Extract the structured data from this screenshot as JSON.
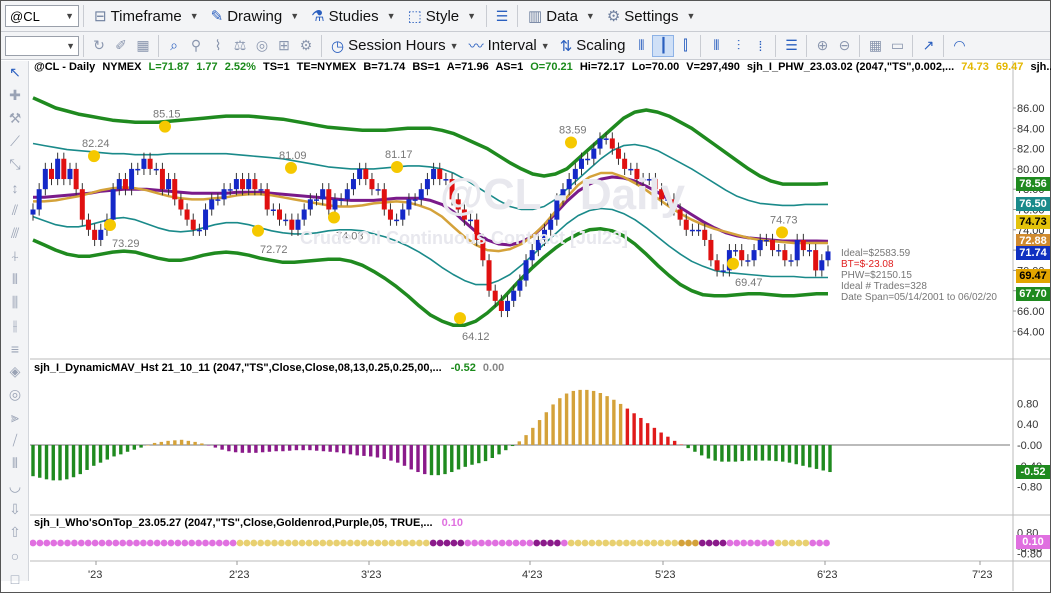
{
  "toolbar": {
    "symbol": "@CL",
    "timeframe": "Timeframe",
    "drawing": "Drawing",
    "studies": "Studies",
    "style": "Style",
    "data": "Data",
    "settings": "Settings",
    "session_hours": "Session Hours",
    "interval": "Interval",
    "scaling": "Scaling"
  },
  "legend": {
    "symbol": "@CL - Daily",
    "exchange": "NYMEX",
    "last": "L=71.87",
    "change": "1.77",
    "pct": "2.52%",
    "ts": "TS=1",
    "te": "TE=NYMEX",
    "bid": "B=71.74",
    "bs": "BS=1",
    "ask": "A=71.96",
    "as": "AS=1",
    "open": "O=70.21",
    "hi": "Hi=72.17",
    "lo": "Lo=70.00",
    "vol": "V=297,490",
    "study": "sjh_I_PHW_23.03.02 (2047,\"TS\",0.002,...",
    "v1": "74.73",
    "v2": "69.47",
    "tail": "sjh..."
  },
  "watermark": {
    "main": "@CL - Daily",
    "sub": "Crude Oil Continuous Contract [Jul23]"
  },
  "stats": [
    "Ideal=$2583.59",
    "BT=$-23.08",
    "PHW=$2150.15",
    "Ideal # Trades=328",
    "Date Span=05/14/2001 to 06/02/20"
  ],
  "indicator1": {
    "label": "sjh_I_DynamicMAV_Hst 21_10_11 (2047,\"TS\",Close,Close,08,13,0.25,0.25,00,...",
    "v1": "-0.52",
    "v2": "0.00"
  },
  "indicator2": {
    "label": "sjh_I_Who'sOnTop_23.05.27 (2047,\"TS\",Close,Goldenrod,Purple,05,  TRUE,...",
    "v1": "0.10"
  },
  "price_axis": [
    "86.00",
    "84.00",
    "82.00",
    "80.00",
    "78.00",
    "76.00",
    "74.00",
    "72.00",
    "70.00",
    "68.00",
    "66.00",
    "64.00"
  ],
  "price_boxes": [
    {
      "label": "78.56",
      "color": "#1f8a1f",
      "value": 78.56
    },
    {
      "label": "76.50",
      "color": "#1a8a8a",
      "value": 76.5
    },
    {
      "label": "74.73",
      "color": "#e3c20a",
      "value": 74.73
    },
    {
      "label": "72.88",
      "color": "#d08a2e",
      "value": 72.9
    },
    {
      "label": "71.74",
      "color": "#1030c0",
      "value": 71.74
    },
    {
      "label": "69.47",
      "color": "#e3a500",
      "value": 69.47
    },
    {
      "label": "67.70",
      "color": "#1f8a1f",
      "value": 67.7
    }
  ],
  "ind1_axis": [
    "0.80",
    "0.40",
    "-0.00",
    "-0.40",
    "-0.80"
  ],
  "ind1_box": {
    "label": "-0.52",
    "value": -0.52
  },
  "ind2_axis": [
    "0.80",
    "0.10",
    "-0.40",
    "-0.80"
  ],
  "ind2_box": {
    "label": "0.10",
    "value": 0.1
  },
  "x_axis": [
    "'23",
    "2'23",
    "3'23",
    "4'23",
    "5'23",
    "6'23",
    "7'23"
  ],
  "peak_labels": [
    "82.24",
    "85.15",
    "81.09",
    "81.17",
    "83.59",
    "74.73"
  ],
  "trough_labels": [
    "73.29",
    "72.72",
    "74.03",
    "64.12",
    "69.47"
  ],
  "colors": {
    "up": "#1428c8",
    "down": "#e01010",
    "outer": "#1f8a1f",
    "inner": "#1a8a8a",
    "purple": "#7a1a8a",
    "gold": "#d4a23a",
    "dot": "#f5c800"
  },
  "chart_data": {
    "type": "line",
    "price_range": [
      63,
      87
    ],
    "x_range": [
      0,
      160
    ],
    "close": [
      76,
      78,
      80,
      79,
      81,
      79,
      80,
      78,
      75,
      74,
      73,
      74,
      75,
      78,
      79,
      78,
      80,
      80,
      81,
      80,
      80,
      78,
      79,
      77,
      76,
      75,
      74,
      74,
      76,
      77,
      77,
      78,
      78,
      79,
      78,
      79,
      78,
      78,
      76,
      76,
      75,
      75,
      74,
      75,
      76,
      77,
      77,
      78,
      76,
      77,
      77,
      78,
      79,
      80,
      79,
      78,
      78,
      76,
      75,
      75,
      76,
      77,
      77,
      78,
      79,
      80,
      79,
      79,
      77,
      76,
      75,
      75,
      73,
      71,
      68,
      67,
      66,
      67,
      68,
      69,
      71,
      72,
      73,
      74,
      75,
      77,
      78,
      79,
      80,
      81,
      81,
      82,
      83,
      83,
      82,
      81,
      80,
      80,
      79,
      79,
      79,
      78,
      77,
      77,
      76,
      75,
      74,
      74,
      74,
      73,
      71,
      70,
      70,
      72,
      72,
      71,
      71,
      72,
      73,
      73,
      72,
      72,
      71,
      71,
      73,
      72,
      72,
      70,
      71,
      71.87
    ],
    "outer_upper": [
      87,
      86.5,
      86,
      85.7,
      85.4,
      85.2,
      85,
      84.8,
      84.7,
      84.6,
      84.6,
      84.6,
      84.7,
      84.8,
      84.9,
      85,
      85.1,
      85.2,
      85.2,
      85.2,
      85.1,
      85,
      84.9,
      84.7,
      84.5,
      84.3,
      84.1,
      84,
      83.9,
      83.8,
      83.8,
      83.8,
      83.9,
      84,
      84,
      84,
      83.8,
      83.5,
      83,
      82.5,
      82,
      81.3,
      80.6,
      80,
      79.5,
      79.3,
      79.5,
      80,
      81,
      82,
      83,
      84,
      85,
      85.6,
      85.8,
      85.6,
      85.2,
      84.6,
      84,
      83.2,
      82.4,
      81.6,
      80.8,
      80,
      79.3,
      78.8,
      78.5,
      78.5,
      78.5,
      78.5,
      78.56
    ],
    "inner_upper": [
      82.5,
      82.3,
      82.1,
      81.9,
      81.8,
      81.7,
      81.6,
      81.5,
      81.5,
      81.4,
      81.4,
      81.4,
      81.5,
      81.5,
      81.5,
      81.5,
      81.5,
      81.5,
      81.4,
      81.3,
      81.2,
      81.1,
      81,
      80.8,
      80.6,
      80.4,
      80.2,
      80.1,
      80,
      80,
      80,
      80.1,
      80.2,
      80.3,
      80.3,
      80.2,
      80,
      79.6,
      79,
      78.3,
      77.6,
      76.9,
      76.3,
      76,
      76,
      76.3,
      77,
      78,
      79,
      80,
      81,
      81.8,
      82.3,
      82.4,
      82.2,
      81.8,
      81.2,
      80.6,
      80,
      79.3,
      78.6,
      77.9,
      77.3,
      76.9,
      76.6,
      76.5,
      76.4,
      76.4,
      76.5,
      76.5,
      76.5
    ],
    "purple": [
      77.2,
      77.2,
      77.3,
      77.4,
      77.5,
      77.6,
      77.8,
      77.9,
      78,
      78,
      78,
      77.9,
      77.8,
      77.7,
      77.6,
      77.6,
      77.6,
      77.6,
      77.7,
      77.7,
      77.7,
      77.6,
      77.5,
      77.4,
      77.3,
      77.2,
      77.1,
      77,
      76.9,
      76.9,
      76.9,
      77,
      77.1,
      77.1,
      77.1,
      76.9,
      76.5,
      75.8,
      74.8,
      73.8,
      73,
      72.6,
      72.5,
      72.8,
      73.4,
      74.4,
      75.6,
      76.8,
      77.8,
      78.5,
      79,
      79.2,
      79.1,
      78.8,
      78.3,
      77.7,
      77,
      76.2,
      75.5,
      74.8,
      74.2,
      73.7,
      73.4,
      73.2,
      73.1,
      73,
      72.9,
      72.9,
      72.9,
      72.9,
      72.88
    ],
    "gold": [
      76.8,
      76.8,
      76.9,
      77.1,
      77.3,
      77.6,
      77.9,
      78.1,
      78.2,
      78.1,
      77.9,
      77.6,
      77.3,
      77.1,
      77,
      77,
      77.1,
      77.2,
      77.4,
      77.5,
      77.5,
      77.4,
      77.2,
      77,
      76.8,
      76.6,
      76.4,
      76.3,
      76.3,
      76.4,
      76.6,
      76.7,
      76.8,
      76.7,
      76.4,
      76,
      75.3,
      74.3,
      73.3,
      72.5,
      72,
      71.9,
      72.1,
      72.6,
      73.4,
      74.5,
      75.8,
      77.2,
      78.4,
      79.2,
      79.6,
      79.6,
      79.2,
      78.6,
      77.9,
      77.1,
      76.3,
      75.6,
      75,
      74.5,
      74.1,
      73.8,
      73.5,
      73.2,
      73,
      72.9,
      72.8,
      72.7,
      72.7,
      72.7,
      72.7
    ],
    "inner_lower": [
      75.3,
      74.9,
      74.5,
      74.3,
      74.3,
      74.5,
      74.8,
      75.1,
      75.2,
      75,
      74.6,
      74.2,
      73.9,
      73.8,
      73.9,
      74.2,
      74.5,
      74.7,
      74.7,
      74.5,
      74.2,
      73.9,
      73.7,
      73.6,
      73.6,
      73.7,
      73.9,
      74,
      74,
      73.9,
      73.6,
      73.3,
      72.9,
      72.4,
      71.8,
      71.1,
      70.3,
      69.6,
      69,
      68.6,
      68.6,
      69,
      69.6,
      70.5,
      71.5,
      72.6,
      73.6,
      74.6,
      75.4,
      75.9,
      76.1,
      76,
      75.6,
      75,
      74.2,
      73.3,
      72.4,
      71.6,
      70.9,
      70.4,
      70,
      69.8,
      69.7,
      69.6,
      69.5,
      69.4,
      69.4,
      69.4,
      69.3,
      69.3,
      69.3
    ],
    "outer_lower": [
      73,
      72.5,
      72,
      71.6,
      71.4,
      71.4,
      71.6,
      71.8,
      71.9,
      71.8,
      71.5,
      71.2,
      71,
      71,
      71.2,
      71.5,
      71.7,
      71.8,
      71.7,
      71.5,
      71.2,
      71,
      70.8,
      70.8,
      70.9,
      71,
      71.1,
      71.1,
      70.9,
      70.5,
      69.9,
      69.2,
      68.4,
      67.5,
      66.5,
      65.6,
      65,
      64.6,
      64.6,
      65,
      65.8,
      66.8,
      68,
      69.2,
      70.3,
      71.3,
      72.2,
      73,
      73.6,
      74,
      74.1,
      73.9,
      73.4,
      72.6,
      71.6,
      70.5,
      69.5,
      68.6,
      68,
      67.6,
      67.5,
      67.5,
      67.6,
      67.7,
      67.7,
      67.6,
      67.5,
      67.5,
      67.6,
      67.7,
      67.7
    ],
    "histogram": [
      -0.6,
      -0.63,
      -0.66,
      -0.68,
      -0.68,
      -0.66,
      -0.62,
      -0.56,
      -0.48,
      -0.4,
      -0.34,
      -0.28,
      -0.22,
      -0.18,
      -0.13,
      -0.09,
      -0.05,
      0.0,
      0.04,
      0.06,
      0.08,
      0.09,
      0.1,
      0.08,
      0.06,
      0.03,
      -0.01,
      -0.05,
      -0.09,
      -0.12,
      -0.14,
      -0.15,
      -0.15,
      -0.15,
      -0.14,
      -0.13,
      -0.12,
      -0.12,
      -0.11,
      -0.1,
      -0.1,
      -0.1,
      -0.11,
      -0.12,
      -0.13,
      -0.14,
      -0.16,
      -0.18,
      -0.2,
      -0.21,
      -0.22,
      -0.24,
      -0.27,
      -0.3,
      -0.34,
      -0.4,
      -0.47,
      -0.52,
      -0.56,
      -0.58,
      -0.58,
      -0.56,
      -0.52,
      -0.47,
      -0.42,
      -0.38,
      -0.35,
      -0.31,
      -0.25,
      -0.18,
      -0.1,
      -0.02,
      0.07,
      0.19,
      0.33,
      0.48,
      0.63,
      0.78,
      0.9,
      0.99,
      1.04,
      1.06,
      1.06,
      1.04,
      1.0,
      0.94,
      0.87,
      0.79,
      0.7,
      0.61,
      0.52,
      0.42,
      0.33,
      0.24,
      0.16,
      0.08,
      0.01,
      -0.06,
      -0.13,
      -0.2,
      -0.26,
      -0.3,
      -0.32,
      -0.32,
      -0.32,
      -0.31,
      -0.3,
      -0.3,
      -0.3,
      -0.3,
      -0.31,
      -0.32,
      -0.34,
      -0.37,
      -0.4,
      -0.43,
      -0.46,
      -0.49,
      -0.52
    ]
  }
}
